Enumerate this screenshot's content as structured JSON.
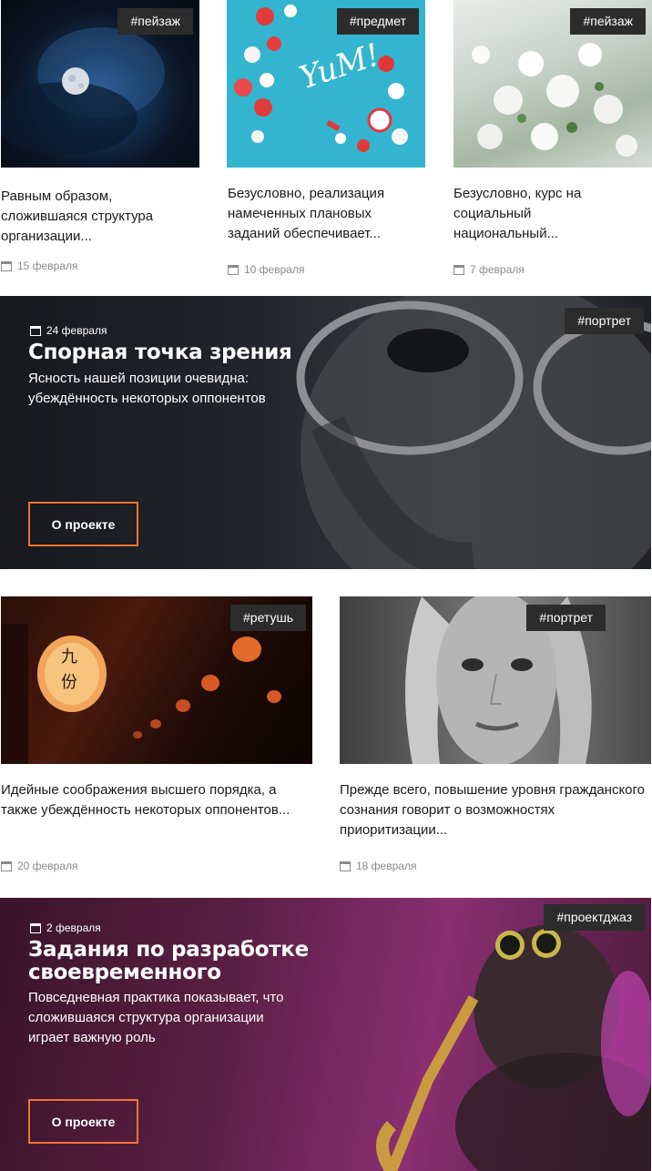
{
  "cards_row1": [
    {
      "tag": "#пейзаж",
      "excerpt": "Равным образом, сложившаяся структура организации...",
      "date": "15 февраля",
      "image": "night sky with moon"
    },
    {
      "tag": "#предмет",
      "excerpt": "Безусловно, реализация намеченных плановых заданий обеспечивает...",
      "date": "10 февраля",
      "image": "macarons on blue with Yum text"
    },
    {
      "tag": "#пейзаж",
      "excerpt": "Безусловно, курс на социальный национальный...",
      "date": "7 февраля",
      "image": "white blossoms"
    }
  ],
  "banner1": {
    "tag": "#портрет",
    "date": "24 февраля",
    "title": "Спорная точка зрения",
    "text": "Ясность нашей позиции очевидна: убеждённость некоторых оппонентов",
    "button": "О проекте"
  },
  "cards_row2": [
    {
      "tag": "#ретушь",
      "excerpt": "Идейные соображения высшего порядка, а также убеждённость некоторых оппонентов...",
      "date": "20 февраля",
      "image": "paper lanterns"
    },
    {
      "tag": "#портрет",
      "excerpt": "Прежде всего, повышение уровня гражданского сознания говорит о возможностях приоритизации...",
      "date": "18 февраля",
      "image": "freckled girl portrait"
    }
  ],
  "banner2": {
    "tag": "#проектджаз",
    "date": "2 февраля",
    "title_line1": "Задания по разработке",
    "title_line2": "своевременного",
    "text": "Повседневная практика показывает, что сложившаяся структура организации играет важную роль",
    "button": "О проекте"
  },
  "colors": {
    "accent": "#f07333",
    "tag_bg": "#2c2c2c",
    "date_gray": "#8a8a8a"
  },
  "icons": {
    "date": "calendar-icon"
  }
}
